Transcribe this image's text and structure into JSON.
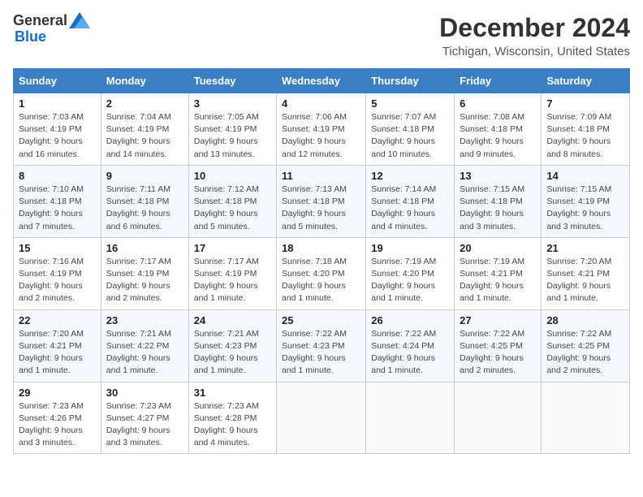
{
  "header": {
    "logo_general": "General",
    "logo_blue": "Blue",
    "month_title": "December 2024",
    "location": "Tichigan, Wisconsin, United States"
  },
  "weekdays": [
    "Sunday",
    "Monday",
    "Tuesday",
    "Wednesday",
    "Thursday",
    "Friday",
    "Saturday"
  ],
  "weeks": [
    [
      {
        "day": "1",
        "sunrise": "7:03 AM",
        "sunset": "4:19 PM",
        "daylight": "9 hours and 16 minutes."
      },
      {
        "day": "2",
        "sunrise": "7:04 AM",
        "sunset": "4:19 PM",
        "daylight": "9 hours and 14 minutes."
      },
      {
        "day": "3",
        "sunrise": "7:05 AM",
        "sunset": "4:19 PM",
        "daylight": "9 hours and 13 minutes."
      },
      {
        "day": "4",
        "sunrise": "7:06 AM",
        "sunset": "4:19 PM",
        "daylight": "9 hours and 12 minutes."
      },
      {
        "day": "5",
        "sunrise": "7:07 AM",
        "sunset": "4:18 PM",
        "daylight": "9 hours and 10 minutes."
      },
      {
        "day": "6",
        "sunrise": "7:08 AM",
        "sunset": "4:18 PM",
        "daylight": "9 hours and 9 minutes."
      },
      {
        "day": "7",
        "sunrise": "7:09 AM",
        "sunset": "4:18 PM",
        "daylight": "9 hours and 8 minutes."
      }
    ],
    [
      {
        "day": "8",
        "sunrise": "7:10 AM",
        "sunset": "4:18 PM",
        "daylight": "9 hours and 7 minutes."
      },
      {
        "day": "9",
        "sunrise": "7:11 AM",
        "sunset": "4:18 PM",
        "daylight": "9 hours and 6 minutes."
      },
      {
        "day": "10",
        "sunrise": "7:12 AM",
        "sunset": "4:18 PM",
        "daylight": "9 hours and 5 minutes."
      },
      {
        "day": "11",
        "sunrise": "7:13 AM",
        "sunset": "4:18 PM",
        "daylight": "9 hours and 5 minutes."
      },
      {
        "day": "12",
        "sunrise": "7:14 AM",
        "sunset": "4:18 PM",
        "daylight": "9 hours and 4 minutes."
      },
      {
        "day": "13",
        "sunrise": "7:15 AM",
        "sunset": "4:18 PM",
        "daylight": "9 hours and 3 minutes."
      },
      {
        "day": "14",
        "sunrise": "7:15 AM",
        "sunset": "4:19 PM",
        "daylight": "9 hours and 3 minutes."
      }
    ],
    [
      {
        "day": "15",
        "sunrise": "7:16 AM",
        "sunset": "4:19 PM",
        "daylight": "9 hours and 2 minutes."
      },
      {
        "day": "16",
        "sunrise": "7:17 AM",
        "sunset": "4:19 PM",
        "daylight": "9 hours and 2 minutes."
      },
      {
        "day": "17",
        "sunrise": "7:17 AM",
        "sunset": "4:19 PM",
        "daylight": "9 hours and 1 minute."
      },
      {
        "day": "18",
        "sunrise": "7:18 AM",
        "sunset": "4:20 PM",
        "daylight": "9 hours and 1 minute."
      },
      {
        "day": "19",
        "sunrise": "7:19 AM",
        "sunset": "4:20 PM",
        "daylight": "9 hours and 1 minute."
      },
      {
        "day": "20",
        "sunrise": "7:19 AM",
        "sunset": "4:21 PM",
        "daylight": "9 hours and 1 minute."
      },
      {
        "day": "21",
        "sunrise": "7:20 AM",
        "sunset": "4:21 PM",
        "daylight": "9 hours and 1 minute."
      }
    ],
    [
      {
        "day": "22",
        "sunrise": "7:20 AM",
        "sunset": "4:21 PM",
        "daylight": "9 hours and 1 minute."
      },
      {
        "day": "23",
        "sunrise": "7:21 AM",
        "sunset": "4:22 PM",
        "daylight": "9 hours and 1 minute."
      },
      {
        "day": "24",
        "sunrise": "7:21 AM",
        "sunset": "4:23 PM",
        "daylight": "9 hours and 1 minute."
      },
      {
        "day": "25",
        "sunrise": "7:22 AM",
        "sunset": "4:23 PM",
        "daylight": "9 hours and 1 minute."
      },
      {
        "day": "26",
        "sunrise": "7:22 AM",
        "sunset": "4:24 PM",
        "daylight": "9 hours and 1 minute."
      },
      {
        "day": "27",
        "sunrise": "7:22 AM",
        "sunset": "4:25 PM",
        "daylight": "9 hours and 2 minutes."
      },
      {
        "day": "28",
        "sunrise": "7:22 AM",
        "sunset": "4:25 PM",
        "daylight": "9 hours and 2 minutes."
      }
    ],
    [
      {
        "day": "29",
        "sunrise": "7:23 AM",
        "sunset": "4:26 PM",
        "daylight": "9 hours and 3 minutes."
      },
      {
        "day": "30",
        "sunrise": "7:23 AM",
        "sunset": "4:27 PM",
        "daylight": "9 hours and 3 minutes."
      },
      {
        "day": "31",
        "sunrise": "7:23 AM",
        "sunset": "4:28 PM",
        "daylight": "9 hours and 4 minutes."
      },
      null,
      null,
      null,
      null
    ]
  ],
  "labels": {
    "sunrise": "Sunrise:",
    "sunset": "Sunset:",
    "daylight": "Daylight:"
  }
}
